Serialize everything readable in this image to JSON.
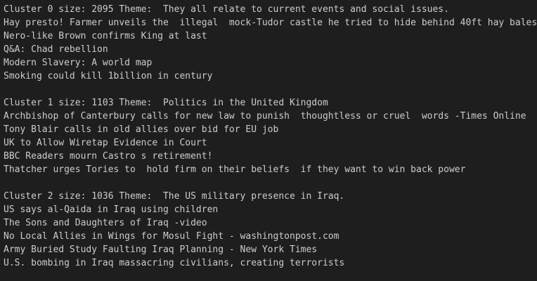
{
  "clusters": [
    {
      "header": "Cluster 0 size: 2095 Theme:  They all relate to current events and social issues.",
      "items": [
        "Hay presto! Farmer unveils the  illegal  mock-Tudor castle he tried to hide behind 40ft hay bales",
        "Nero-like Brown confirms King at last",
        "Q&A: Chad rebellion",
        "Modern Slavery: A world map",
        "Smoking could kill 1billion in century"
      ]
    },
    {
      "header": "Cluster 1 size: 1103 Theme:  Politics in the United Kingdom",
      "items": [
        "Archbishop of Canterbury calls for new law to punish  thoughtless or cruel  words -Times Online",
        "Tony Blair calls in old allies over bid for EU job",
        "UK to Allow Wiretap Evidence in Court",
        "BBC Readers mourn Castro s retirement!",
        "Thatcher urges Tories to  hold firm on their beliefs  if they want to win back power"
      ]
    },
    {
      "header": "Cluster 2 size: 1036 Theme:  The US military presence in Iraq.",
      "items": [
        "US says al-Qaida in Iraq using children",
        "The Sons and Daughters of Iraq -video",
        "No Local Allies in Wings for Mosul Fight - washingtonpost.com",
        "Army Buried Study Faulting Iraq Planning - New York Times",
        "U.S. bombing in Iraq massacring civilians, creating terrorists"
      ]
    }
  ]
}
